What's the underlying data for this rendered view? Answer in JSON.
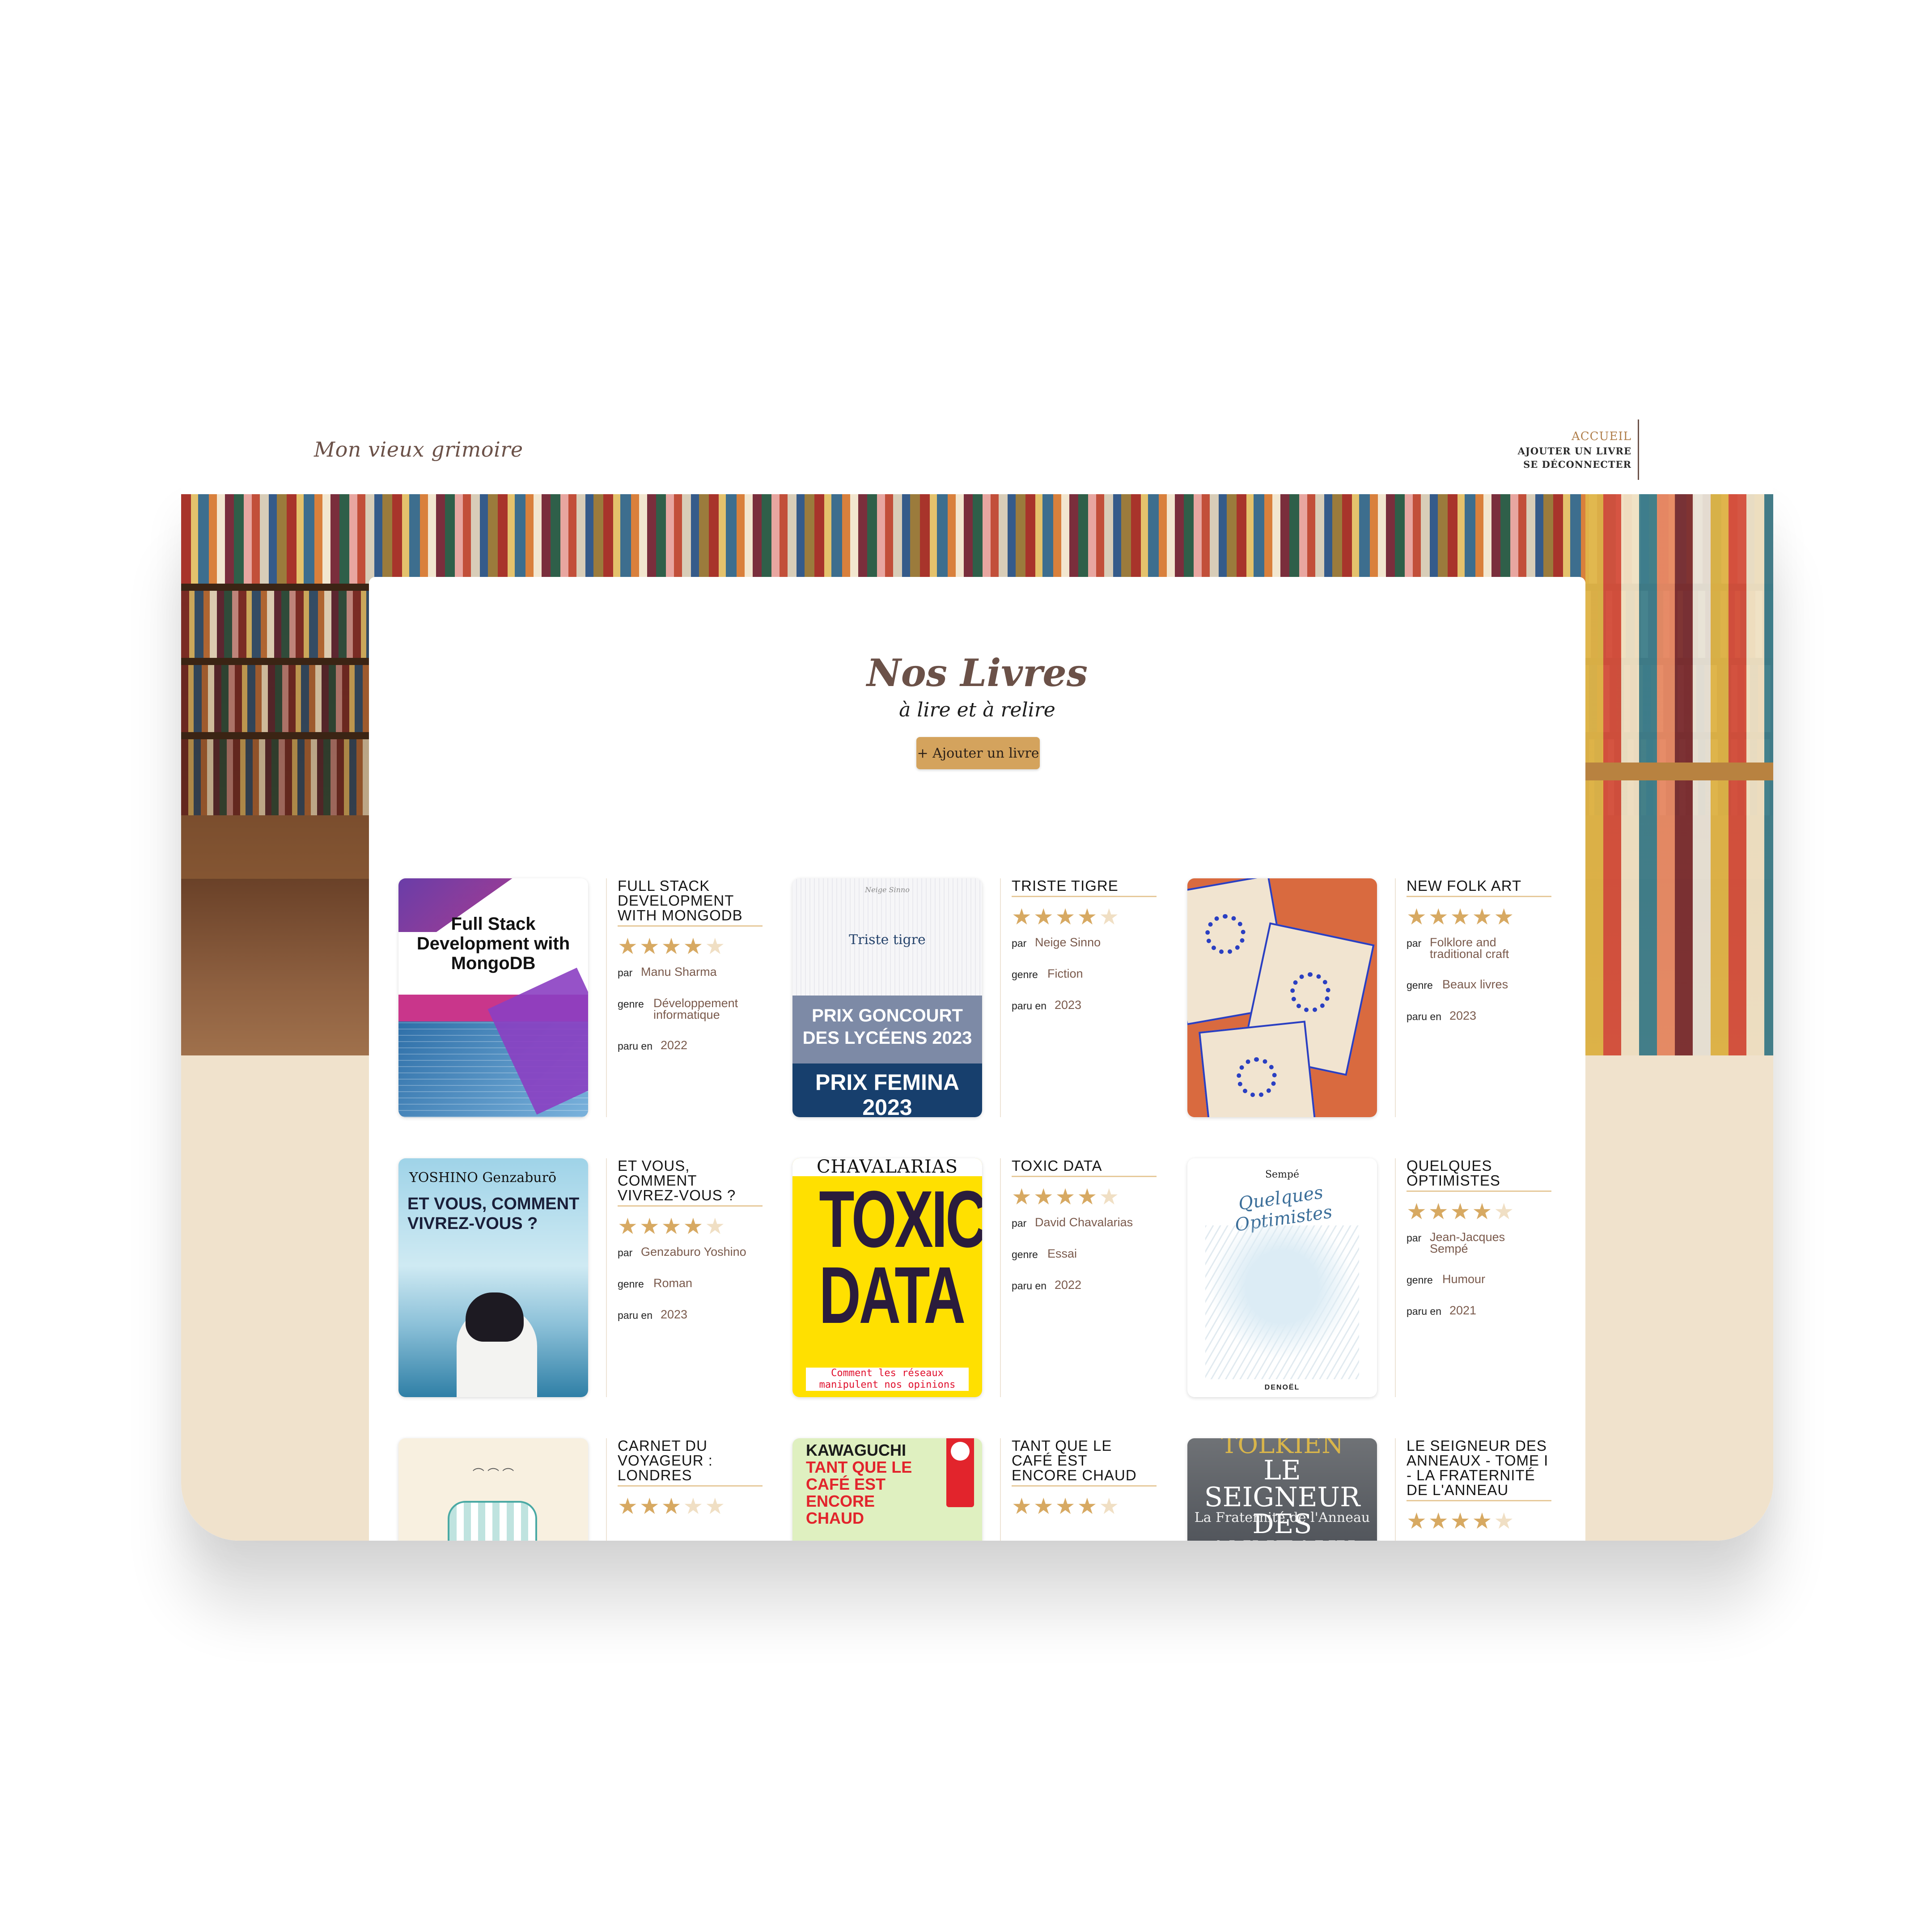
{
  "header": {
    "logo": "Mon vieux grimoire",
    "nav": {
      "home": "ACCUEIL",
      "add": "AJOUTER UN LIVRE",
      "logout": "SE DÉCONNECTER"
    }
  },
  "main": {
    "title": "Nos Livres",
    "subtitle": "à lire et à relire",
    "add_button": "+ Ajouter un livre"
  },
  "labels": {
    "by": "par",
    "genre": "genre",
    "year": "paru en"
  },
  "colors": {
    "accent": "#d4a35d",
    "brand_text": "#6b5148",
    "beige": "#f0e2cc"
  },
  "books": [
    {
      "title": "FULL STACK DEVELOPMENT WITH MONGODB",
      "rating": 4,
      "author": "Manu Sharma",
      "genre": "Développement informatique",
      "year": "2022",
      "cover": {
        "title": "Full Stack Development with MongoDB"
      }
    },
    {
      "title": "TRISTE TIGRE",
      "rating": 4,
      "author": "Neige Sinno",
      "genre": "Fiction",
      "year": "2023",
      "cover": {
        "author": "Neige Sinno",
        "title": "Triste tigre",
        "band1": "PRIX GONCOURT DES LYCÉENS 2023",
        "band2": "PRIX FEMINA 2023"
      }
    },
    {
      "title": "NEW FOLK ART",
      "rating": 5,
      "author": "Folklore and traditional craft",
      "genre": "Beaux livres",
      "year": "2023",
      "cover": {}
    },
    {
      "title": "ET VOUS, COMMENT VIVREZ-VOUS ?",
      "rating": 4,
      "author": "Genzaburo Yoshino",
      "genre": "Roman",
      "year": "2023",
      "cover": {
        "author": "YOSHINO Genzaburō",
        "title": "ET VOUS, COMMENT VIVREZ-VOUS ?"
      }
    },
    {
      "title": "TOXIC DATA",
      "rating": 4,
      "author": "David Chavalarias",
      "genre": "Essai",
      "year": "2022",
      "cover": {
        "author": "CHAVALARIAS",
        "title": "TOXIC DATA",
        "subtitle": "Comment les réseaux manipulent nos opinions"
      }
    },
    {
      "title": "QUELQUES OPTIMISTES",
      "rating": 4,
      "author": "Jean-Jacques Sempé",
      "genre": "Humour",
      "year": "2021",
      "cover": {
        "author": "Sempé",
        "title": "Quelques Optimistes",
        "publisher": "DENOËL"
      }
    },
    {
      "title": "CARNET DU VOYAGEUR : LONDRES",
      "rating": 3,
      "cover": {}
    },
    {
      "title": "TANT QUE LE CAFÉ EST ENCORE CHAUD",
      "rating": 4,
      "cover": {
        "author": "KAWAGUCHI",
        "title": "TANT QUE LE CAFÉ EST ENCORE CHAUD"
      }
    },
    {
      "title": "LE SEIGNEUR DES ANNEAUX - TOME I - LA FRATERNITÉ DE L'ANNEAU",
      "rating": 4,
      "cover": {
        "author": "TOLKIEN",
        "title": "LE SEIGNEUR DES ANNEAUX",
        "subtitle": "La Fraternité de l'Anneau"
      }
    }
  ]
}
